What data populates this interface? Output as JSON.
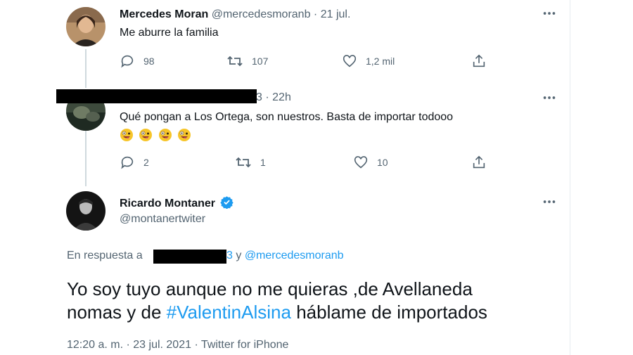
{
  "tweet1": {
    "name": "Mercedes Moran",
    "handle": "@mercedesmoranb",
    "sep": "·",
    "date": "21 jul.",
    "text": "Me aburre la familia",
    "replies": "98",
    "retweets": "107",
    "likes": "1,2 mil"
  },
  "tweet2": {
    "handle_visible_suffix": "3",
    "sep": "·",
    "time": "22h",
    "text": "Qué pongan a Los Ortega, son nuestros. Basta de importar todooo",
    "emoji_count": 4,
    "replies": "2",
    "retweets": "1",
    "likes": "10"
  },
  "main": {
    "name": "Ricardo Montaner",
    "handle": "@montanertwiter",
    "reply_prefix": "En respuesta a",
    "reply_suffix": "3",
    "reply_and": "y",
    "reply_mention": "@mercedesmoranb",
    "text_line1": "Yo soy tuyo aunque no me quieras ,de Avellaneda",
    "text_line2_pre": "nomas y de",
    "hashtag": "#ValentinAlsina",
    "text_line2_post": "háblame de importados",
    "timestamp": "12:20 a. m. · 23 jul. 2021 · Twitter for iPhone"
  },
  "icons": {
    "more": "more-icon",
    "reply": "reply-icon",
    "retweet": "retweet-icon",
    "like": "heart-icon",
    "share": "share-icon",
    "verified": "verified-badge-icon"
  },
  "colors": {
    "accent": "#1d9bf0",
    "secondary_text": "#536471",
    "primary_text": "#0f1419"
  }
}
